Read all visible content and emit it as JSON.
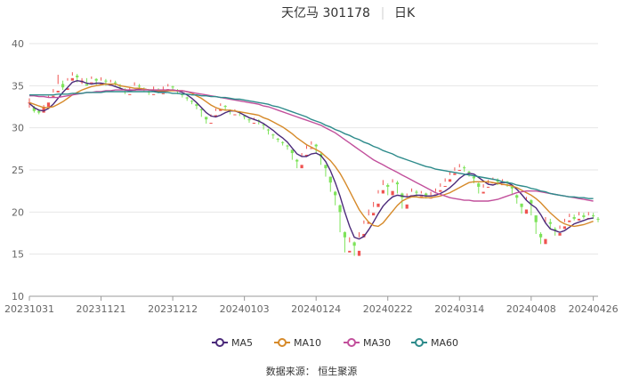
{
  "title": {
    "name": "天亿马 301178",
    "period": "日K"
  },
  "source": "数据来源： 恒生聚源",
  "colors": {
    "up": "#ef5350",
    "down": "#7ee35a",
    "MA5": "#4b2a7a",
    "MA10": "#d68a2a",
    "MA30": "#c2509c",
    "MA60": "#2e8b8b",
    "grid": "#e6e6e6",
    "axis": "#999999"
  },
  "chart_data": {
    "type": "candlestick",
    "xlabel": "",
    "ylabel": "",
    "ylim": [
      10,
      40
    ],
    "yticks": [
      10,
      15,
      20,
      25,
      30,
      35,
      40
    ],
    "xticks": [
      "20231031",
      "20231121",
      "20231212",
      "20240103",
      "20240124",
      "20240222",
      "20240314",
      "20240408",
      "20240426"
    ],
    "xtick_index": [
      0,
      15,
      30,
      45,
      60,
      75,
      90,
      105,
      118
    ],
    "grid": true,
    "legend": "bottom-center",
    "candles": [
      [
        33,
        33.0,
        32.4,
        33.5,
        32.2
      ],
      [
        32.4,
        32.0,
        31.8,
        32.6,
        31.6
      ],
      [
        32.0,
        31.8,
        31.6,
        32.2,
        31.4
      ],
      [
        31.8,
        32.5,
        31.9,
        32.7,
        31.6
      ],
      [
        32.5,
        33.0,
        33.6,
        33.8,
        32.8
      ],
      [
        33.6,
        33.8,
        34.2,
        34.6,
        33.4
      ],
      [
        34.2,
        34.4,
        35.2,
        36.3,
        34.0
      ],
      [
        35.2,
        34.8,
        34.5,
        35.6,
        34.2
      ],
      [
        34.5,
        34.7,
        35.6,
        35.9,
        34.4
      ],
      [
        35.6,
        35.9,
        36.2,
        36.6,
        35.5
      ],
      [
        36.2,
        36.0,
        35.4,
        36.4,
        35.2
      ],
      [
        35.4,
        35.6,
        35.2,
        35.9,
        34.8
      ],
      [
        35.2,
        35.0,
        35.4,
        35.9,
        34.8
      ],
      [
        35.4,
        35.4,
        35.8,
        36.1,
        35.1
      ],
      [
        35.8,
        35.6,
        35.1,
        35.9,
        34.9
      ],
      [
        35.1,
        35.2,
        35.6,
        36.0,
        34.9
      ],
      [
        35.6,
        35.5,
        35.0,
        35.8,
        34.7
      ],
      [
        35.0,
        35.1,
        35.4,
        35.7,
        34.9
      ],
      [
        35.4,
        35.3,
        35.0,
        35.6,
        34.7
      ],
      [
        35.0,
        34.9,
        34.6,
        35.2,
        34.3
      ],
      [
        34.6,
        34.5,
        34.0,
        34.7,
        33.7
      ],
      [
        34.0,
        34.0,
        34.4,
        34.8,
        33.8
      ],
      [
        34.4,
        34.5,
        35.0,
        35.4,
        34.3
      ],
      [
        35.0,
        34.9,
        34.6,
        35.2,
        34.3
      ],
      [
        34.6,
        34.5,
        34.3,
        34.8,
        34.0
      ],
      [
        34.3,
        34.2,
        33.9,
        34.4,
        33.6
      ],
      [
        33.9,
        34.0,
        34.5,
        34.9,
        33.8
      ],
      [
        34.5,
        34.4,
        34.1,
        34.7,
        33.9
      ],
      [
        34.1,
        34.1,
        34.5,
        34.9,
        33.9
      ],
      [
        34.5,
        34.6,
        34.9,
        35.2,
        34.4
      ],
      [
        34.9,
        34.8,
        34.4,
        35.0,
        34.2
      ],
      [
        34.4,
        34.3,
        34.0,
        34.6,
        33.8
      ],
      [
        34.0,
        33.9,
        33.6,
        34.1,
        33.3
      ],
      [
        33.6,
        33.5,
        33.2,
        33.7,
        32.9
      ],
      [
        33.2,
        33.1,
        32.8,
        33.3,
        32.5
      ],
      [
        32.8,
        32.6,
        32.2,
        32.9,
        31.9
      ],
      [
        32.2,
        32.1,
        31.3,
        32.3,
        30.9
      ],
      [
        31.3,
        31.0,
        30.5,
        31.3,
        30.2
      ],
      [
        30.5,
        30.6,
        31.3,
        31.6,
        30.4
      ],
      [
        31.3,
        31.5,
        32.0,
        32.3,
        31.1
      ],
      [
        32.0,
        32.2,
        32.6,
        32.9,
        31.9
      ],
      [
        32.6,
        32.5,
        32.1,
        32.7,
        31.8
      ],
      [
        32.1,
        32.0,
        31.6,
        32.2,
        31.3
      ],
      [
        31.6,
        31.6,
        31.9,
        32.2,
        31.4
      ],
      [
        31.9,
        31.8,
        31.4,
        32.0,
        31.0
      ],
      [
        31.4,
        31.3,
        31.0,
        31.5,
        30.7
      ],
      [
        31.0,
        30.9,
        30.6,
        31.1,
        30.3
      ],
      [
        30.6,
        30.6,
        30.9,
        31.2,
        30.4
      ],
      [
        30.9,
        30.8,
        30.4,
        31.0,
        30.1
      ],
      [
        30.4,
        30.3,
        29.8,
        30.5,
        29.5
      ],
      [
        29.8,
        29.7,
        29.2,
        29.9,
        28.9
      ],
      [
        29.2,
        29.1,
        28.7,
        29.3,
        28.4
      ],
      [
        28.7,
        28.6,
        28.3,
        28.8,
        28.0
      ],
      [
        28.3,
        28.2,
        27.9,
        28.4,
        27.6
      ],
      [
        27.9,
        27.8,
        27.4,
        28.0,
        27.1
      ],
      [
        27.4,
        27.0,
        26.2,
        27.4,
        25.8
      ],
      [
        26.2,
        26.0,
        25.2,
        26.3,
        24.9
      ],
      [
        25.2,
        25.6,
        26.6,
        27.0,
        25.1
      ],
      [
        26.6,
        26.8,
        27.5,
        27.9,
        26.5
      ],
      [
        27.5,
        27.6,
        28.0,
        28.4,
        27.2
      ],
      [
        28.0,
        27.8,
        26.9,
        28.1,
        26.5
      ],
      [
        26.9,
        26.6,
        25.6,
        27.0,
        25.2
      ],
      [
        25.6,
        25.2,
        24.2,
        25.6,
        23.8
      ],
      [
        24.2,
        23.5,
        22.4,
        24.2,
        22.0
      ],
      [
        22.4,
        22.0,
        20.8,
        22.5,
        20.4
      ],
      [
        20.8,
        20.0,
        17.6,
        20.9,
        16.8
      ],
      [
        17.6,
        17.0,
        15.2,
        17.7,
        14.6
      ],
      [
        15.2,
        15.4,
        16.4,
        17.0,
        14.4
      ],
      [
        16.4,
        16.0,
        14.8,
        16.5,
        14.3
      ],
      [
        14.8,
        15.4,
        17.0,
        17.6,
        14.7
      ],
      [
        17.0,
        17.4,
        18.6,
        19.0,
        16.8
      ],
      [
        18.6,
        18.8,
        19.6,
        20.3,
        18.4
      ],
      [
        19.6,
        19.9,
        20.6,
        21.2,
        19.4
      ],
      [
        20.6,
        21.0,
        22.2,
        22.6,
        20.4
      ],
      [
        22.2,
        22.6,
        23.2,
        23.8,
        22.0
      ],
      [
        23.2,
        23.0,
        22.0,
        23.4,
        21.6
      ],
      [
        22.0,
        22.5,
        23.5,
        23.9,
        21.8
      ],
      [
        23.5,
        23.3,
        22.2,
        23.7,
        21.6
      ],
      [
        22.2,
        21.7,
        20.4,
        22.3,
        20.1
      ],
      [
        20.4,
        20.9,
        21.8,
        22.2,
        20.2
      ],
      [
        21.8,
        22.0,
        22.4,
        22.8,
        21.5
      ],
      [
        22.4,
        22.3,
        21.8,
        22.6,
        21.4
      ],
      [
        21.8,
        21.9,
        22.2,
        22.5,
        21.5
      ],
      [
        22.2,
        22.0,
        21.6,
        22.3,
        21.2
      ],
      [
        21.6,
        21.7,
        22.0,
        22.4,
        21.4
      ],
      [
        22.0,
        22.1,
        22.4,
        22.8,
        21.8
      ],
      [
        22.4,
        22.6,
        23.0,
        23.4,
        22.2
      ],
      [
        23.0,
        23.1,
        23.6,
        24.0,
        22.8
      ],
      [
        23.6,
        23.9,
        24.4,
        24.8,
        23.4
      ],
      [
        24.4,
        24.6,
        24.9,
        25.3,
        24.2
      ],
      [
        24.9,
        25.0,
        25.3,
        25.7,
        24.6
      ],
      [
        25.3,
        25.2,
        24.8,
        25.5,
        24.4
      ],
      [
        24.8,
        24.7,
        24.2,
        24.9,
        23.9
      ],
      [
        24.2,
        24.0,
        23.4,
        24.3,
        23.0
      ],
      [
        23.4,
        23.0,
        22.2,
        23.5,
        21.9
      ],
      [
        22.2,
        22.4,
        22.9,
        23.3,
        22.0
      ],
      [
        22.9,
        23.0,
        23.4,
        23.8,
        22.7
      ],
      [
        23.4,
        23.5,
        23.8,
        24.1,
        23.2
      ],
      [
        23.8,
        23.6,
        23.2,
        24.0,
        22.9
      ],
      [
        23.2,
        23.3,
        23.6,
        23.9,
        23.0
      ],
      [
        23.6,
        23.5,
        23.0,
        23.7,
        22.7
      ],
      [
        23.0,
        22.8,
        22.0,
        23.1,
        21.7
      ],
      [
        22.0,
        21.7,
        21.0,
        22.1,
        20.7
      ],
      [
        21.0,
        20.6,
        19.8,
        21.0,
        19.5
      ],
      [
        19.8,
        20.3,
        21.4,
        21.8,
        19.6
      ],
      [
        21.4,
        21.0,
        19.6,
        21.5,
        19.2
      ],
      [
        19.6,
        18.8,
        17.4,
        19.6,
        17.0
      ],
      [
        17.4,
        17.0,
        16.2,
        17.6,
        15.9
      ],
      [
        16.2,
        16.8,
        18.8,
        19.4,
        16.0
      ],
      [
        18.8,
        18.6,
        18.0,
        19.2,
        17.6
      ],
      [
        18.0,
        17.8,
        17.2,
        18.2,
        16.8
      ],
      [
        17.2,
        17.5,
        18.0,
        18.4,
        17.0
      ],
      [
        18.0,
        18.3,
        18.8,
        19.2,
        17.8
      ],
      [
        18.8,
        19.0,
        19.4,
        19.8,
        18.5
      ],
      [
        19.4,
        19.2,
        19.0,
        19.7,
        18.6
      ],
      [
        19.0,
        19.2,
        19.6,
        20.0,
        18.8
      ],
      [
        19.6,
        19.4,
        19.2,
        19.9,
        18.9
      ],
      [
        19.2,
        19.3,
        19.6,
        20.0,
        19.0
      ],
      [
        19.6,
        19.5,
        19.2,
        19.9,
        18.8
      ],
      [
        19.2,
        19.1,
        18.8,
        19.4,
        18.5
      ]
    ],
    "series": [
      {
        "name": "MA5",
        "values": [
          32.9,
          32.4,
          32.1,
          32.0,
          32.3,
          32.8,
          33.5,
          34.2,
          34.8,
          35.4,
          35.6,
          35.5,
          35.3,
          35.2,
          35.3,
          35.3,
          35.2,
          35.1,
          34.9,
          34.7,
          34.5,
          34.4,
          34.5,
          34.6,
          34.6,
          34.5,
          34.4,
          34.3,
          34.3,
          34.4,
          34.5,
          34.4,
          34.2,
          33.9,
          33.5,
          33.0,
          32.4,
          31.8,
          31.4,
          31.3,
          31.5,
          31.8,
          32.0,
          32.0,
          31.8,
          31.5,
          31.2,
          31.0,
          30.8,
          30.5,
          30.1,
          29.7,
          29.2,
          28.8,
          28.3,
          27.6,
          26.9,
          26.6,
          26.6,
          26.9,
          27.0,
          26.7,
          26.0,
          24.9,
          23.5,
          21.9,
          20.0,
          18.3,
          17.0,
          16.8,
          17.1,
          17.9,
          18.8,
          19.8,
          20.7,
          21.3,
          21.8,
          22.0,
          21.9,
          21.8,
          21.9,
          22.0,
          22.0,
          21.9,
          21.9,
          22.0,
          22.2,
          22.5,
          22.9,
          23.4,
          24.0,
          24.4,
          24.6,
          24.5,
          24.1,
          23.7,
          23.3,
          23.2,
          23.4,
          23.5,
          23.5,
          23.2,
          22.7,
          22.1,
          21.4,
          20.9,
          20.5,
          19.7,
          18.7,
          18.0,
          17.8,
          17.6,
          17.8,
          18.2,
          18.6,
          18.8,
          19.0,
          19.2,
          19.3
        ]
      },
      {
        "name": "MA10",
        "values": [
          33.0,
          32.8,
          32.6,
          32.4,
          32.4,
          32.5,
          32.8,
          33.1,
          33.5,
          33.9,
          34.2,
          34.5,
          34.7,
          34.9,
          35.0,
          35.1,
          35.2,
          35.2,
          35.2,
          35.0,
          34.9,
          34.8,
          34.7,
          34.7,
          34.6,
          34.5,
          34.5,
          34.4,
          34.4,
          34.4,
          34.4,
          34.4,
          34.4,
          34.3,
          34.1,
          33.8,
          33.5,
          33.1,
          32.7,
          32.4,
          32.2,
          32.1,
          32.1,
          32.0,
          31.9,
          31.8,
          31.7,
          31.6,
          31.5,
          31.2,
          31.0,
          30.7,
          30.4,
          30.1,
          29.7,
          29.3,
          28.8,
          28.4,
          28.0,
          27.7,
          27.4,
          27.1,
          26.6,
          26.1,
          25.4,
          24.6,
          23.6,
          22.5,
          21.4,
          20.3,
          19.5,
          18.8,
          18.4,
          18.3,
          18.7,
          19.4,
          20.1,
          20.8,
          21.3,
          21.6,
          21.8,
          21.8,
          21.7,
          21.7,
          21.7,
          21.8,
          21.9,
          22.1,
          22.3,
          22.6,
          22.9,
          23.2,
          23.5,
          23.6,
          23.6,
          23.6,
          23.6,
          23.5,
          23.4,
          23.3,
          23.2,
          23.1,
          22.9,
          22.6,
          22.3,
          22.0,
          21.6,
          21.1,
          20.5,
          19.9,
          19.4,
          18.9,
          18.6,
          18.4,
          18.3,
          18.4,
          18.5,
          18.7,
          18.9
        ]
      },
      {
        "name": "MA30",
        "values": [
          33.8,
          33.8,
          33.7,
          33.7,
          33.6,
          33.6,
          33.6,
          33.7,
          33.8,
          33.9,
          34.0,
          34.1,
          34.2,
          34.2,
          34.3,
          34.3,
          34.4,
          34.4,
          34.5,
          34.5,
          34.5,
          34.5,
          34.5,
          34.5,
          34.5,
          34.5,
          34.5,
          34.5,
          34.5,
          34.5,
          34.5,
          34.4,
          34.4,
          34.3,
          34.2,
          34.1,
          34.0,
          33.9,
          33.8,
          33.7,
          33.6,
          33.5,
          33.4,
          33.3,
          33.2,
          33.1,
          33.0,
          32.9,
          32.8,
          32.6,
          32.5,
          32.3,
          32.1,
          31.9,
          31.7,
          31.5,
          31.3,
          31.1,
          30.9,
          30.7,
          30.5,
          30.3,
          30.0,
          29.7,
          29.4,
          29.0,
          28.6,
          28.2,
          27.8,
          27.4,
          27.0,
          26.6,
          26.2,
          25.9,
          25.6,
          25.3,
          25.0,
          24.7,
          24.4,
          24.1,
          23.8,
          23.5,
          23.2,
          22.9,
          22.6,
          22.3,
          22.1,
          21.9,
          21.7,
          21.6,
          21.5,
          21.4,
          21.4,
          21.3,
          21.3,
          21.3,
          21.3,
          21.4,
          21.5,
          21.7,
          21.9,
          22.1,
          22.3,
          22.4,
          22.5,
          22.5,
          22.5,
          22.4,
          22.3,
          22.2,
          22.1,
          22.0,
          21.9,
          21.8,
          21.7,
          21.6,
          21.5,
          21.4,
          21.3
        ]
      },
      {
        "name": "MA60",
        "values": [
          33.9,
          33.9,
          33.9,
          33.9,
          33.9,
          33.9,
          34.0,
          34.0,
          34.0,
          34.1,
          34.1,
          34.1,
          34.2,
          34.2,
          34.2,
          34.2,
          34.3,
          34.3,
          34.3,
          34.3,
          34.3,
          34.3,
          34.3,
          34.3,
          34.3,
          34.3,
          34.3,
          34.2,
          34.2,
          34.2,
          34.1,
          34.1,
          34.0,
          34.0,
          33.9,
          33.9,
          33.8,
          33.8,
          33.7,
          33.7,
          33.6,
          33.6,
          33.5,
          33.4,
          33.4,
          33.3,
          33.2,
          33.1,
          33.0,
          32.9,
          32.8,
          32.6,
          32.5,
          32.3,
          32.1,
          31.9,
          31.7,
          31.5,
          31.3,
          31.0,
          30.8,
          30.6,
          30.3,
          30.1,
          29.8,
          29.6,
          29.3,
          29.1,
          28.8,
          28.6,
          28.3,
          28.1,
          27.8,
          27.6,
          27.3,
          27.1,
          26.9,
          26.6,
          26.4,
          26.2,
          26.0,
          25.8,
          25.6,
          25.4,
          25.3,
          25.1,
          25.0,
          24.9,
          24.8,
          24.7,
          24.6,
          24.5,
          24.4,
          24.3,
          24.2,
          24.1,
          24.0,
          23.9,
          23.8,
          23.6,
          23.5,
          23.4,
          23.2,
          23.1,
          23.0,
          22.8,
          22.7,
          22.5,
          22.4,
          22.2,
          22.1,
          22.0,
          21.9,
          21.8,
          21.8,
          21.7,
          21.7,
          21.6,
          21.6
        ]
      }
    ]
  }
}
